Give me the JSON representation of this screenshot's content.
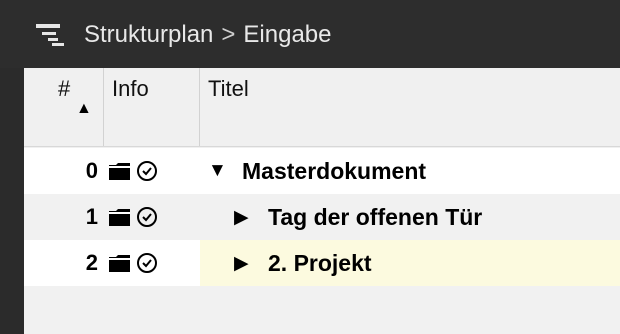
{
  "breadcrumb": {
    "items": [
      "Strukturplan",
      "Eingabe"
    ],
    "separator": ">"
  },
  "toolbar_icon": "outline-structure-icon",
  "table": {
    "columns": [
      {
        "key": "num",
        "label": "#",
        "sort": "ascending"
      },
      {
        "key": "info",
        "label": "Info"
      },
      {
        "key": "title",
        "label": "Titel"
      }
    ],
    "rows": [
      {
        "num": "0",
        "title": "Masterdokument",
        "level": 0,
        "expanded": true,
        "icons": [
          "folder-icon",
          "clock-icon"
        ]
      },
      {
        "num": "1",
        "title": "Tag der offenen Tür",
        "level": 1,
        "expanded": false,
        "icons": [
          "folder-icon",
          "clock-icon"
        ]
      },
      {
        "num": "2",
        "title": "2. Projekt",
        "level": 1,
        "expanded": false,
        "selected": true,
        "icons": [
          "folder-icon",
          "clock-icon"
        ]
      }
    ]
  },
  "colors": {
    "titlebar": "#2d2d2d",
    "selected_row": "#fcfadf",
    "header": "#f0f0f0",
    "alt_row": "#f1f1f1"
  }
}
